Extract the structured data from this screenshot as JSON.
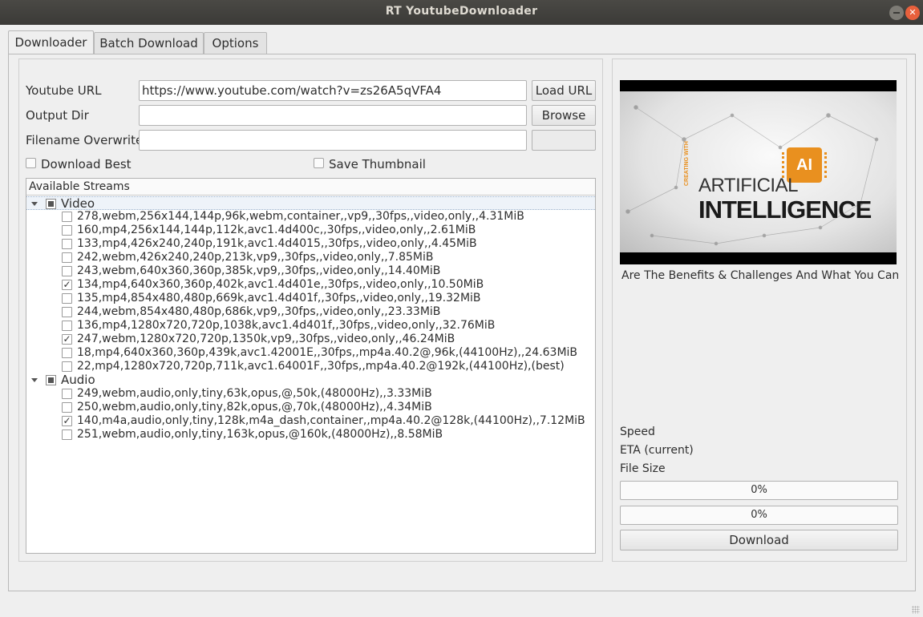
{
  "window": {
    "title": "RT YoutubeDownloader"
  },
  "tabs": [
    {
      "label": "Downloader",
      "active": true
    },
    {
      "label": "Batch Download",
      "active": false
    },
    {
      "label": "Options",
      "active": false
    }
  ],
  "form": {
    "url_label": "Youtube URL",
    "url_value": "https://www.youtube.com/watch?v=zs26A5qVFA4",
    "load_button": "Load URL",
    "output_label": "Output Dir",
    "output_value": "",
    "browse_button": "Browse",
    "filename_label": "Filename Overwrite",
    "filename_value": "",
    "download_best_label": "Download Best",
    "save_thumbnail_label": "Save Thumbnail"
  },
  "streams": {
    "header": "Available Streams",
    "categories": [
      {
        "label": "Video",
        "items": [
          {
            "text": "278,webm,256x144,144p,96k,webm,container,,vp9,,30fps,,video,only,,4.31MiB",
            "checked": false
          },
          {
            "text": "160,mp4,256x144,144p,112k,avc1.4d400c,,30fps,,video,only,,2.61MiB",
            "checked": false
          },
          {
            "text": "133,mp4,426x240,240p,191k,avc1.4d4015,,30fps,,video,only,,4.45MiB",
            "checked": false
          },
          {
            "text": "242,webm,426x240,240p,213k,vp9,,30fps,,video,only,,7.85MiB",
            "checked": false
          },
          {
            "text": "243,webm,640x360,360p,385k,vp9,,30fps,,video,only,,14.40MiB",
            "checked": false
          },
          {
            "text": "134,mp4,640x360,360p,402k,avc1.4d401e,,30fps,,video,only,,10.50MiB",
            "checked": true
          },
          {
            "text": "135,mp4,854x480,480p,669k,avc1.4d401f,,30fps,,video,only,,19.32MiB",
            "checked": false
          },
          {
            "text": "244,webm,854x480,480p,686k,vp9,,30fps,,video,only,,23.33MiB",
            "checked": false
          },
          {
            "text": "136,mp4,1280x720,720p,1038k,avc1.4d401f,,30fps,,video,only,,32.76MiB",
            "checked": false
          },
          {
            "text": "247,webm,1280x720,720p,1350k,vp9,,30fps,,video,only,,46.24MiB",
            "checked": true
          },
          {
            "text": "18,mp4,640x360,360p,439k,avc1.42001E,,30fps,,mp4a.40.2@,96k,(44100Hz),,24.63MiB",
            "checked": false
          },
          {
            "text": "22,mp4,1280x720,720p,711k,avc1.64001F,,30fps,,mp4a.40.2@192k,(44100Hz),(best)",
            "checked": false
          }
        ]
      },
      {
        "label": "Audio",
        "items": [
          {
            "text": "249,webm,audio,only,tiny,63k,opus,@,50k,(48000Hz),,3.33MiB",
            "checked": false
          },
          {
            "text": "250,webm,audio,only,tiny,82k,opus,@,70k,(48000Hz),,4.34MiB",
            "checked": false
          },
          {
            "text": "140,m4a,audio,only,tiny,128k,m4a_dash,container,,mp4a.40.2@128k,(44100Hz),,7.12MiB",
            "checked": true
          },
          {
            "text": "251,webm,audio,only,tiny,163k,opus,@160k,(48000Hz),,8.58MiB",
            "checked": false
          }
        ]
      }
    ]
  },
  "preview": {
    "thumb_line1": "ARTIFICIAL",
    "thumb_line2": "INTELLIGENCE",
    "thumb_chip": "AI",
    "thumb_side": "CREATING WITH",
    "video_title": "Are The Benefits & Challenges And What You Can Do"
  },
  "status": {
    "speed_label": "Speed",
    "eta_label": "ETA (current)",
    "filesize_label": "File Size",
    "progress1": "0%",
    "progress2": "0%",
    "download_button": "Download"
  },
  "colors": {
    "titlebar": "#3b3a37",
    "close": "#e8603c",
    "chip": "#e9901f"
  }
}
